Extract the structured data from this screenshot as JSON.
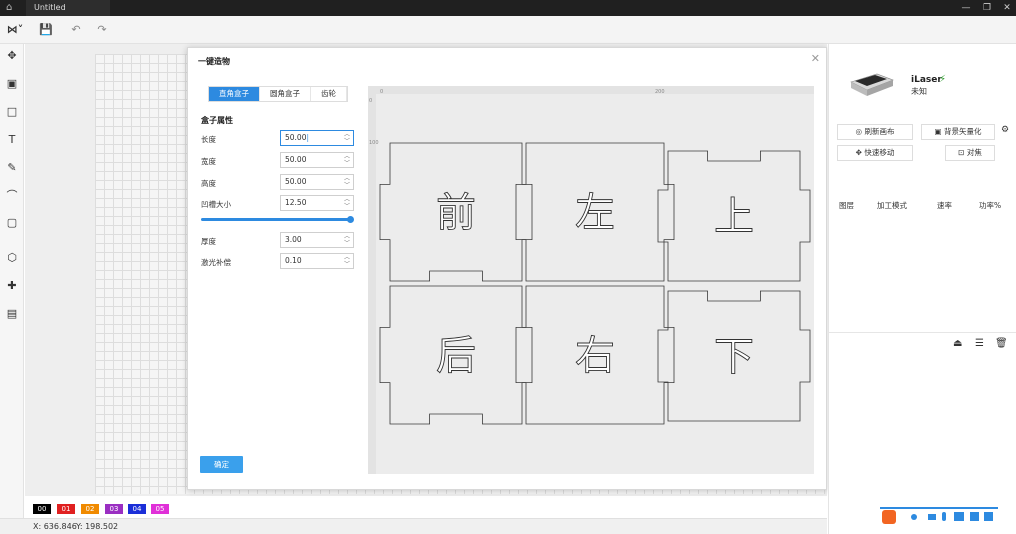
{
  "window": {
    "tab_title": "Untitled"
  },
  "toolbar": {
    "logo_icon": "tool-logo-icon",
    "save_icon": "save-icon",
    "undo_icon": "undo-icon",
    "redo_icon": "redo-icon"
  },
  "left_tools": [
    "move-icon",
    "image-icon",
    "shape-icon",
    "text-icon",
    "pen-icon",
    "path-icon",
    "frame-icon",
    "cube-icon",
    "puzzle-icon",
    "photo-edit-icon"
  ],
  "dialog": {
    "title": "一键造物",
    "tabs": [
      {
        "label": "直角盒子",
        "active": true
      },
      {
        "label": "圆角盒子",
        "active": false
      },
      {
        "label": "齿轮",
        "active": false
      }
    ],
    "section_title": "盒子属性",
    "fields": [
      {
        "label": "长度",
        "value": "50.00"
      },
      {
        "label": "宽度",
        "value": "50.00"
      },
      {
        "label": "高度",
        "value": "50.00"
      },
      {
        "label": "凹槽大小",
        "value": "12.50"
      },
      {
        "label": "厚度",
        "value": "3.00"
      },
      {
        "label": "激光补偿",
        "value": "0.10"
      }
    ],
    "slider_fraction": 1.0,
    "ok_label": "确定",
    "preview_ruler": {
      "x_start": "0",
      "x_mid": "200",
      "y_start": "0",
      "y_mark": "100"
    },
    "faces": [
      "前",
      "左",
      "上",
      "后",
      "右",
      "下"
    ]
  },
  "palette": [
    {
      "label": "00",
      "color": "#000000"
    },
    {
      "label": "01",
      "color": "#e02020"
    },
    {
      "label": "02",
      "color": "#f08a00"
    },
    {
      "label": "03",
      "color": "#9a2fc2"
    },
    {
      "label": "04",
      "color": "#1b2fd8"
    },
    {
      "label": "05",
      "color": "#e030d8"
    }
  ],
  "status": {
    "x": "X: 636.846",
    "y": "Y: 198.502"
  },
  "right_panel": {
    "device_name": "iLaser",
    "device_status": "未知",
    "buttons": [
      "刷新画布",
      "背景矢量化",
      "快速移动",
      "对焦"
    ],
    "table_headers": [
      "图层",
      "加工模式",
      "速率",
      "功率%"
    ]
  }
}
